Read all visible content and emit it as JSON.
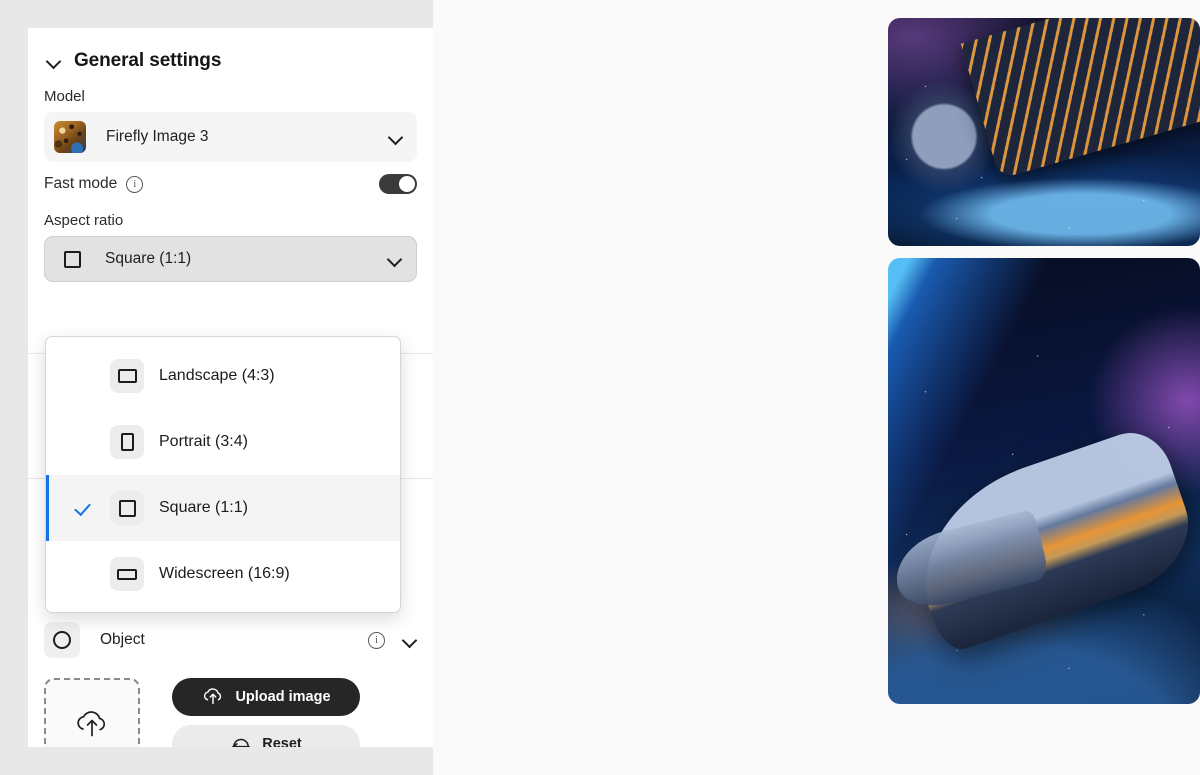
{
  "panel": {
    "header": {
      "title": "General settings",
      "collapse_icon": "chevron-down-icon"
    },
    "model": {
      "label": "Model",
      "value": "Firefly Image 3",
      "thumbnail_icon": "model-thumbnail-leopard",
      "chevron_icon": "chevron-down-icon"
    },
    "fast_mode": {
      "label": "Fast mode",
      "info_icon": "info-icon",
      "info_glyph": "i",
      "toggle_state": "on"
    },
    "aspect_ratio": {
      "label": "Aspect ratio",
      "selected_value": "Square (1:1)",
      "selected_glyph": "square-ratio-icon",
      "chevron_icon": "chevron-down-icon",
      "options": [
        {
          "label": "Landscape (4:3)",
          "glyph": "landscape-ratio-icon",
          "shape": "g-landscape",
          "selected": false
        },
        {
          "label": "Portrait (3:4)",
          "glyph": "portrait-ratio-icon",
          "shape": "g-portrait",
          "selected": false
        },
        {
          "label": "Square (1:1)",
          "glyph": "square-ratio-icon",
          "shape": "g-square",
          "selected": true
        },
        {
          "label": "Widescreen (16:9)",
          "glyph": "widescreen-ratio-icon",
          "shape": "g-wide",
          "selected": false
        }
      ]
    },
    "object_row": {
      "label": "Object",
      "badge_icon": "circle-object-icon",
      "info_icon": "info-icon",
      "info_glyph": "i",
      "chevron_icon": "chevron-down-icon"
    },
    "upload": {
      "dropzone_icon": "cloud-upload-icon",
      "upload_label": "Upload image",
      "upload_icon": "cloud-upload-icon",
      "reset_label": "Reset",
      "reset_icon": "undo-arrow-icon"
    }
  },
  "results": {
    "images": [
      {
        "alt": "spaceship hull over planet with moon"
      },
      {
        "alt": "spaceship flying above planet in nebula"
      }
    ]
  },
  "colors": {
    "accent_blue": "#1473e6",
    "panel_bg": "#ffffff",
    "app_bg": "#e8e8e8",
    "canvas_bg": "#fafafa",
    "primary_button": "#262626"
  }
}
